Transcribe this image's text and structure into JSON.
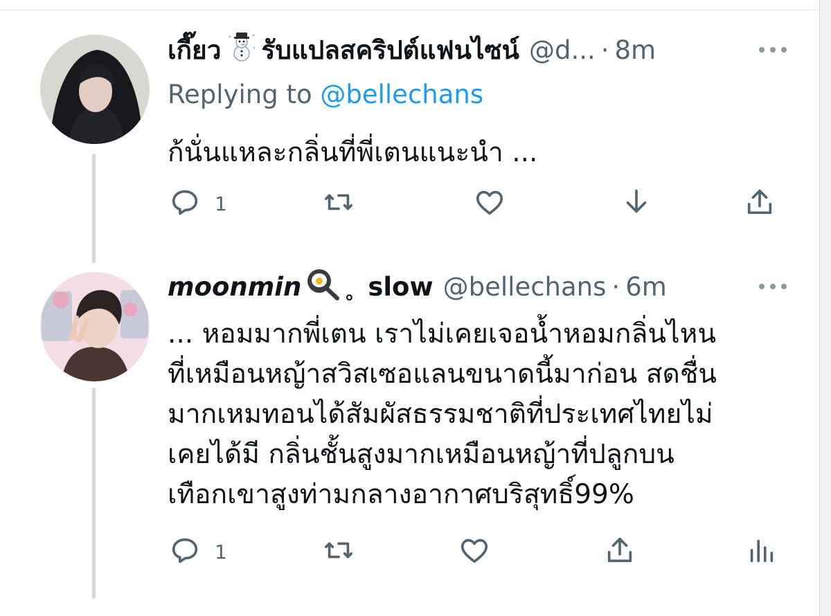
{
  "tweets": [
    {
      "display_name": "เกี๊ยว",
      "name_suffix": "รับแปลสคริปต์แฟนไซน์",
      "handle": "@d...",
      "separator": "·",
      "time": "8m",
      "replying_label": "Replying to",
      "replying_handle": "@bellechans",
      "lines": [
        "ก้นั่นแหละกลิ่นที่พี่เตนแนะนำ ..."
      ],
      "emoji_icon": "snowman-icon",
      "reply_count": "1",
      "actions": [
        "reply-icon",
        "retweet-icon",
        "like-icon",
        "download-icon",
        "share-icon"
      ]
    },
    {
      "display_name": "moonmin",
      "name_suffix": "slow",
      "small_text": "。",
      "handle": "@bellechans",
      "separator": "·",
      "time": "6m",
      "lines": [
        "... หอมมากพี่เตน เราไม่เคยเจอน้ำหอมกลิ่นไหน",
        "ที่เหมือนหญ้าสวิสเซอแลนขนาดนี้มาก่อน สดชื่น",
        "มากเหมทอนได้สัมผัสธรรมชาติที่ประเทศไทยไม่",
        "เคยได้มี กลิ่นชั้นสูงมากเหมือนหญ้าที่ปลูกบน",
        "เทือกเขาสูงท่ามกลางอากาศบริสุทธิ์99%"
      ],
      "emoji_icon": "frying-pan-egg-icon",
      "reply_count": "1",
      "actions": [
        "reply-icon",
        "retweet-icon",
        "like-icon",
        "share-icon",
        "analytics-icon"
      ]
    }
  ],
  "colors": {
    "text": "#0f1419",
    "secondary": "#536471",
    "link": "#1d9bf0",
    "thread_line": "#cfd9de"
  }
}
